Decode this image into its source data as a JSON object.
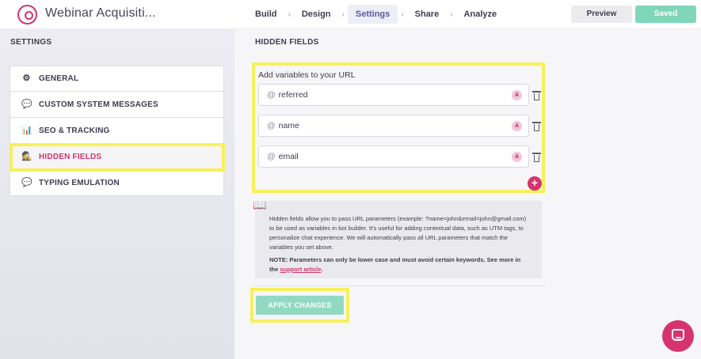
{
  "header": {
    "bot_title": "Webinar Acquisiti...",
    "steps": [
      {
        "label": "Build"
      },
      {
        "label": "Design"
      },
      {
        "label": "Settings",
        "active": true
      },
      {
        "label": "Share"
      },
      {
        "label": "Analyze"
      }
    ],
    "step_separator": "›",
    "preview_label": "Preview",
    "saved_label": "Saved"
  },
  "sidebar": {
    "heading": "SETTINGS",
    "items": [
      {
        "label": "GENERAL",
        "icon": "gear-icon"
      },
      {
        "label": "CUSTOM SYSTEM MESSAGES",
        "icon": "speech-bubble-icon"
      },
      {
        "label": "SEO & TRACKING",
        "icon": "bar-chart-icon"
      },
      {
        "label": "HIDDEN FIELDS",
        "icon": "detective-icon",
        "active": true
      },
      {
        "label": "TYPING EMULATION",
        "icon": "speech-bubble-icon"
      }
    ]
  },
  "main": {
    "heading": "HIDDEN FIELDS",
    "vars_label": "Add variables to your URL",
    "variables": [
      {
        "prefix": "@",
        "name": "referred",
        "badge": "A"
      },
      {
        "prefix": "@",
        "name": "name",
        "badge": "A"
      },
      {
        "prefix": "@",
        "name": "email",
        "badge": "A"
      }
    ],
    "add_button": "+",
    "info": {
      "text": "Hidden fields allow you to pass URL parameters (example: ?name=john&email=john@gmail.com) to be used as variables in bot builder. It's useful for adding contextual data, such as UTM tags, to personalize chat experience. We will automatically pass all URL parameters that match the variables you set above.",
      "note": "NOTE: Parameters can only be lower case and must avoid certain keywords. See more in the",
      "link_text": "support article",
      "note_end": "."
    },
    "apply_label": "APPLY CHANGES"
  },
  "colors": {
    "accent": "#d5346f",
    "success": "#80d6b8",
    "highlight": "#f7f05a"
  }
}
